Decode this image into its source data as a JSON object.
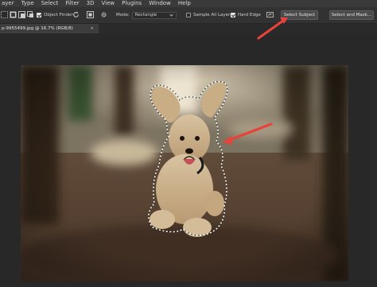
{
  "menubar": {
    "items": [
      "ayer",
      "Type",
      "Select",
      "Filter",
      "3D",
      "View",
      "Plugins",
      "Window",
      "Help"
    ]
  },
  "options": {
    "object_finder": {
      "label": "Object Finder",
      "checked": true
    },
    "mode": {
      "label": "Mode:",
      "value": "Rectangle"
    },
    "sample_all_layers": {
      "label": "Sample All Layers",
      "checked": false
    },
    "hard_edge": {
      "label": "Hard Edge",
      "checked": true
    },
    "select_subject_label": "Select Subject",
    "select_and_mask_label": "Select and Mask..."
  },
  "tabs": [
    {
      "label": "p-9955499.jpg @ 16.7% (RGB/8)",
      "close": "×"
    }
  ],
  "colors": {
    "annotation_arrow": "#e8423a",
    "menubar_bg": "#3a3a3a",
    "options_bg": "#323232",
    "canvas_bg": "#282828"
  },
  "icons": [
    "object-selection-tool-icon",
    "add-selection-icon",
    "subtract-selection-icon",
    "intersect-selection-icon",
    "refresh-icon",
    "show-all-objects-icon",
    "settings-gear-icon",
    "chevron-down-icon",
    "select-subject-options-icon"
  ]
}
